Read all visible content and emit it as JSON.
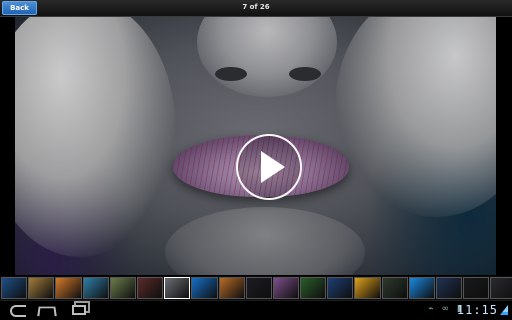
{
  "topbar": {
    "back_label": "Back",
    "counter": "7 of 26"
  },
  "media": {
    "play_icon": "play-icon",
    "colors": {
      "face_light": "#b9b9bb",
      "lips": "#8a6f93",
      "hair": "#e0e0e0",
      "background_shadow": "#1b2030"
    }
  },
  "filmstrip": {
    "selected_index": 6,
    "thumbs": [
      {
        "color": "#1f4f88"
      },
      {
        "color": "#a17c3b"
      },
      {
        "color": "#d47a2b"
      },
      {
        "color": "#2f7fa8"
      },
      {
        "color": "#6b7c4a"
      },
      {
        "color": "#5a2b2b"
      },
      {
        "color": "#6d6f76"
      },
      {
        "color": "#1570c9"
      },
      {
        "color": "#b76c28"
      },
      {
        "color": "#1c1c24"
      },
      {
        "color": "#7e4f8d"
      },
      {
        "color": "#2a5d2a"
      },
      {
        "color": "#1f3f75"
      },
      {
        "color": "#e0a01a"
      },
      {
        "color": "#2d3a2d"
      },
      {
        "color": "#1a88e0"
      },
      {
        "color": "#223355"
      },
      {
        "color": "#1a1a1a"
      },
      {
        "color": "#2b2b30"
      }
    ]
  },
  "navbar": {
    "back_icon": "back-arrow-icon",
    "home_icon": "home-icon",
    "recent_icon": "recent-apps-icon",
    "status_icons": [
      "usb-icon",
      "sync-icon",
      "battery-icon"
    ],
    "clock": "11:15"
  }
}
